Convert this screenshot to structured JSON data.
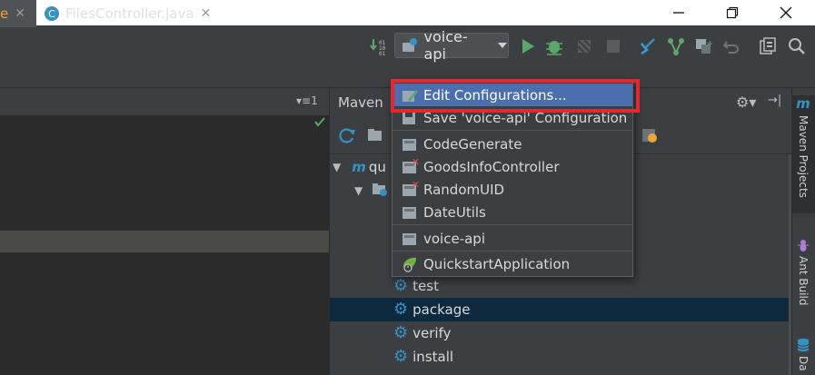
{
  "window": {
    "minimize_glyph": "—",
    "maximize_glyph": "❐",
    "close_glyph": "✕"
  },
  "toolbar": {
    "run_config": "voice-api",
    "icons": [
      "build-icon",
      "run-config-icon",
      "run-icon",
      "debug-icon",
      "coverage-icon",
      "stop-icon",
      "vcs-update-icon",
      "vcs-commit-icon",
      "vcs-compare-icon",
      "revert-icon",
      "project-structure-icon",
      "search-icon"
    ]
  },
  "editor": {
    "tabs": [
      {
        "label": "e",
        "active": true
      },
      {
        "label": "FilesController.java",
        "icon": "C"
      }
    ],
    "tab_overflow": "▾≡1"
  },
  "maven": {
    "title": "Maven",
    "tree": [
      {
        "label": "qu",
        "indent": 0,
        "icon": "maven-project-icon"
      },
      {
        "label": "",
        "indent": 1,
        "icon": "lifecycle-folder-icon"
      },
      {
        "label": "test",
        "indent": 2,
        "icon": "gear-icon"
      },
      {
        "label": "package",
        "indent": 2,
        "icon": "gear-icon",
        "selected": true
      },
      {
        "label": "verify",
        "indent": 2,
        "icon": "gear-icon"
      },
      {
        "label": "install",
        "indent": 2,
        "icon": "gear-icon"
      }
    ]
  },
  "right_sidebar": {
    "tabs": [
      {
        "label": "Maven Projects",
        "icon": "m",
        "active": true
      },
      {
        "label": "Ant Build",
        "icon": "ant-icon"
      },
      {
        "label": "Da",
        "icon": "database-icon"
      }
    ]
  },
  "popup": {
    "items": [
      {
        "label": "Edit Configurations...",
        "icon": "edit-config-icon",
        "highlighted": true
      },
      {
        "label": "Save 'voice-api' Configuration",
        "icon": "save-config-icon"
      },
      {
        "separator": true
      },
      {
        "label": "CodeGenerate",
        "icon": "app-config-icon"
      },
      {
        "label": "GoodsInfoController",
        "icon": "app-config-error-icon"
      },
      {
        "label": "RandomUID",
        "icon": "app-config-error-icon"
      },
      {
        "label": "DateUtils",
        "icon": "app-config-icon"
      },
      {
        "separator": true
      },
      {
        "label": "voice-api",
        "icon": "app-config-icon"
      },
      {
        "separator": true
      },
      {
        "label": "QuickstartApplication",
        "icon": "spring-boot-icon"
      }
    ]
  },
  "colors": {
    "highlight": "#4b6eaf",
    "callout": "#e8262d",
    "selection": "#0d293e"
  }
}
